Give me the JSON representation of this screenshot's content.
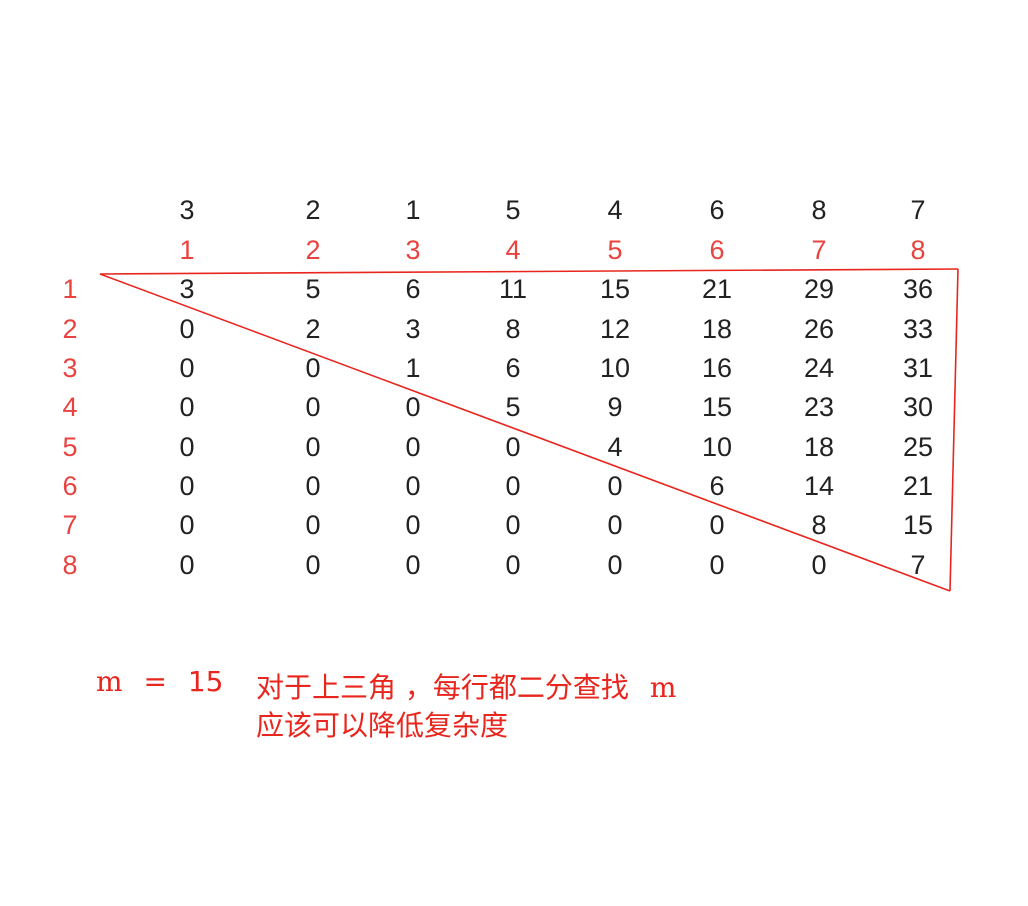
{
  "colors": {
    "index": "#e8433f",
    "values": "#222222",
    "lines": "#e8261e",
    "note": "#e8261e"
  },
  "top_values": [
    "3",
    "2",
    "1",
    "5",
    "4",
    "6",
    "8",
    "7"
  ],
  "col_indices": [
    "1",
    "2",
    "3",
    "4",
    "5",
    "6",
    "7",
    "8"
  ],
  "row_indices": [
    "1",
    "2",
    "3",
    "4",
    "5",
    "6",
    "7",
    "8"
  ],
  "matrix": [
    [
      "3",
      "5",
      "6",
      "11",
      "15",
      "21",
      "29",
      "36"
    ],
    [
      "0",
      "2",
      "3",
      "8",
      "12",
      "18",
      "26",
      "33"
    ],
    [
      "0",
      "0",
      "1",
      "6",
      "10",
      "16",
      "24",
      "31"
    ],
    [
      "0",
      "0",
      "0",
      "5",
      "9",
      "15",
      "23",
      "30"
    ],
    [
      "0",
      "0",
      "0",
      "0",
      "4",
      "10",
      "18",
      "25"
    ],
    [
      "0",
      "0",
      "0",
      "0",
      "0",
      "6",
      "14",
      "21"
    ],
    [
      "0",
      "0",
      "0",
      "0",
      "0",
      "0",
      "8",
      "15"
    ],
    [
      "0",
      "0",
      "0",
      "0",
      "0",
      "0",
      "0",
      "7"
    ]
  ],
  "note": {
    "m_label": "m",
    "m_equals": "=",
    "m_value": "15",
    "line1_text": "对于上三角 ，每行都二分查找",
    "line1_m": "m",
    "line2": "应该可以降低复杂度"
  }
}
